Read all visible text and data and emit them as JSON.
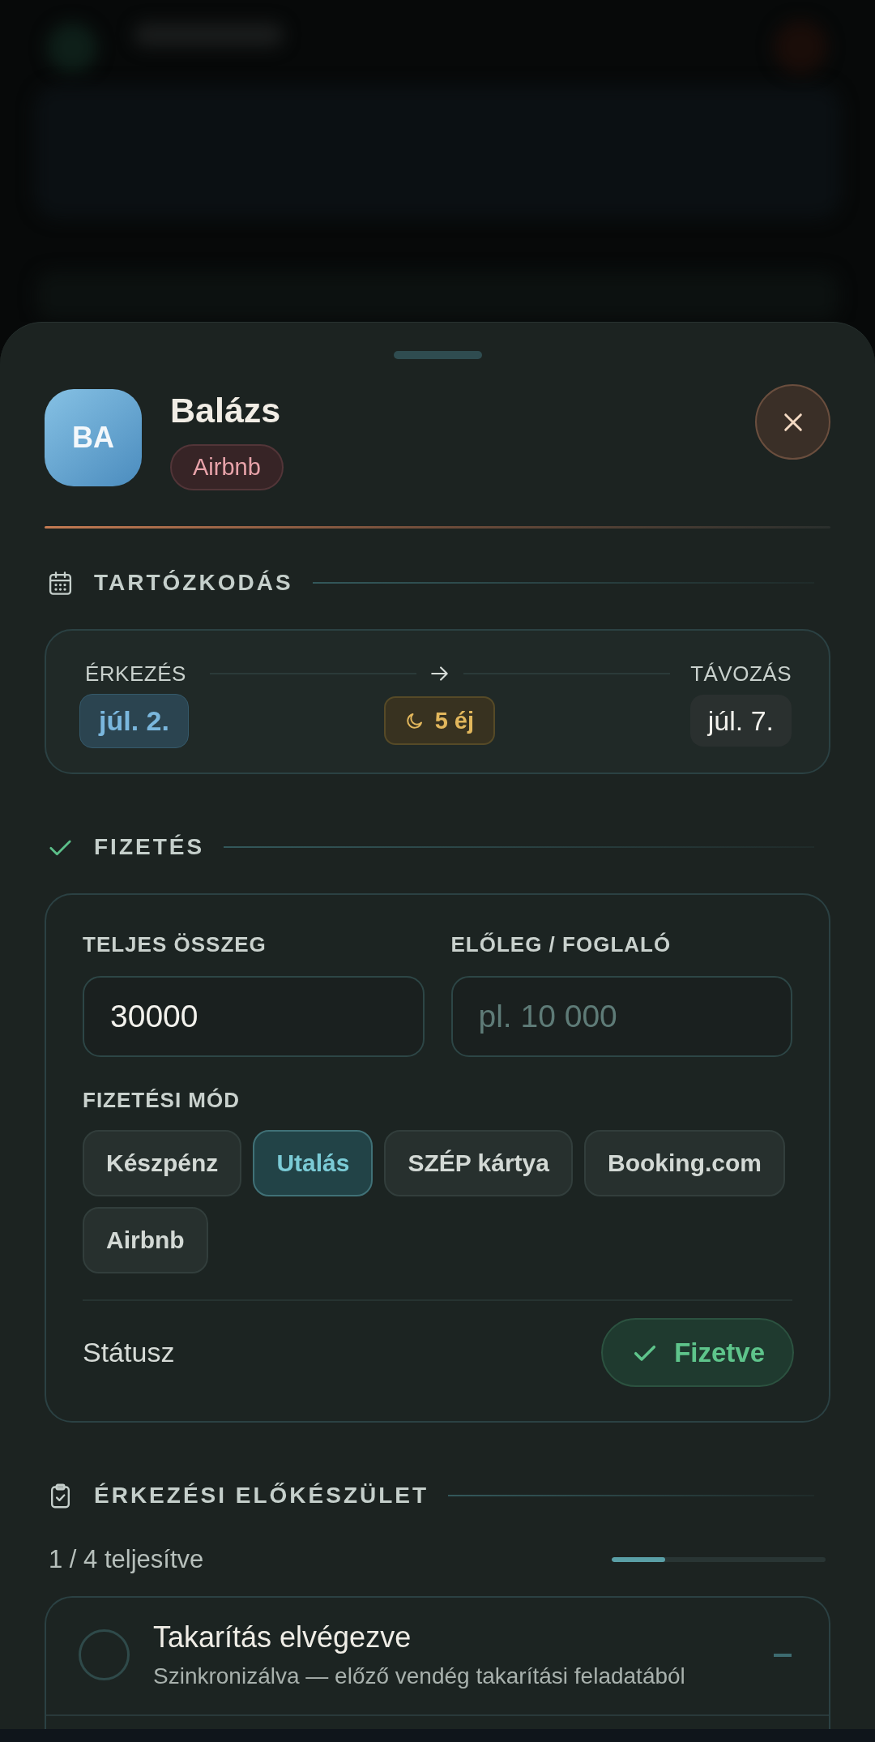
{
  "guest": {
    "initials": "BA",
    "name": "Balázs",
    "source": "Airbnb"
  },
  "stay": {
    "title": "TARTÓZKODÁS",
    "arrival_label": "ÉRKEZÉS",
    "arrival_date": "júl. 2.",
    "nights": "5 éj",
    "departure_label": "TÁVOZÁS",
    "departure_date": "júl. 7."
  },
  "payment": {
    "title": "FIZETÉS",
    "total": {
      "label": "TELJES ÖSSZEG",
      "value": "30000"
    },
    "deposit": {
      "label": "ELŐLEG / FOGLALÓ",
      "placeholder": "pl. 10 000"
    },
    "method_label": "FIZETÉSI MÓD",
    "methods": [
      {
        "label": "Készpénz",
        "selected": false
      },
      {
        "label": "Utalás",
        "selected": true
      },
      {
        "label": "SZÉP kártya",
        "selected": false
      },
      {
        "label": "Booking.com",
        "selected": false
      },
      {
        "label": "Airbnb",
        "selected": false
      }
    ],
    "status_label": "Státusz",
    "status": {
      "label": "Fizetve",
      "paid": true
    }
  },
  "checklist": {
    "title": "ÉRKEZÉSI ELŐKÉSZÜLET",
    "progress_text": "1 / 4 teljesítve",
    "level": 0.25,
    "items": [
      {
        "title": "Takarítás elvégezve",
        "note": "Szinkronizálva — előző vendég takarítási feladatából",
        "checked": false
      }
    ]
  }
}
